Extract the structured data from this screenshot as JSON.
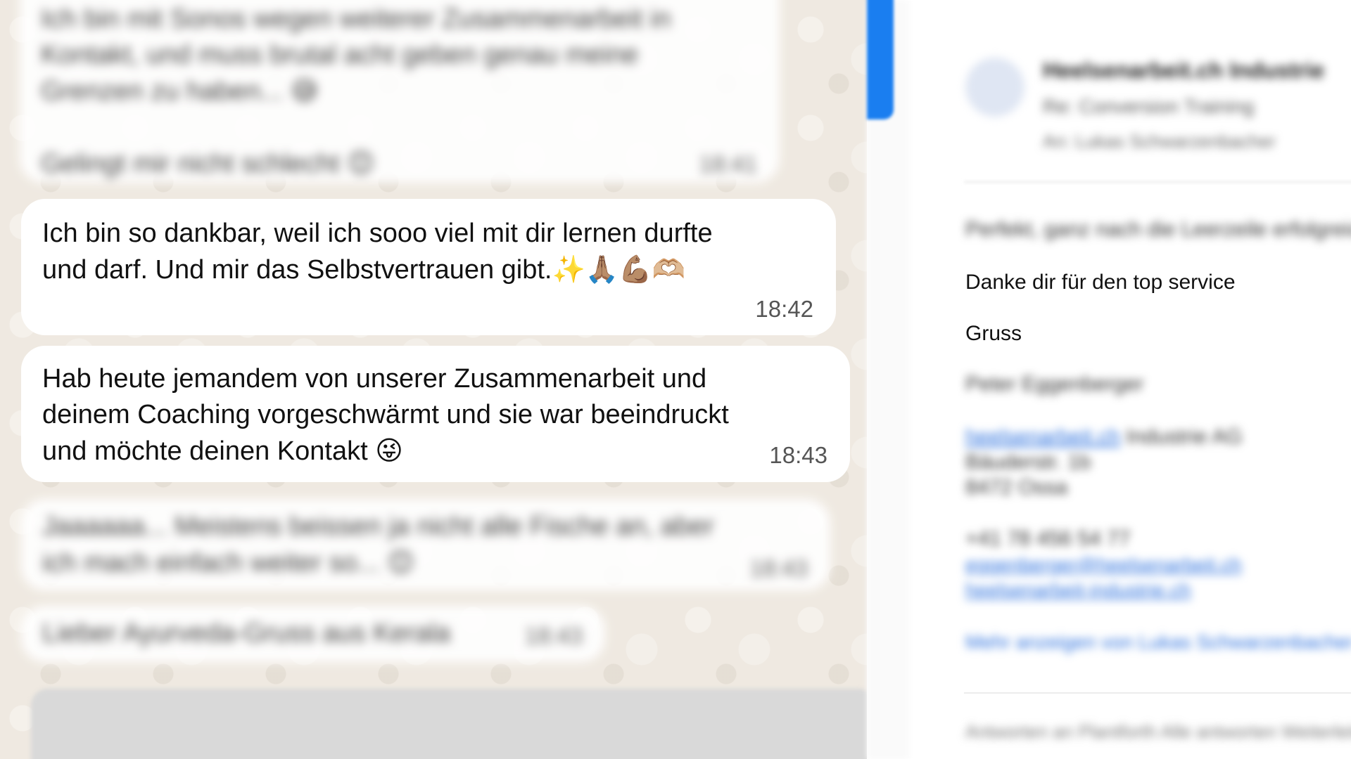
{
  "chat": {
    "messages": [
      {
        "text_line1": "Ich bin mit Sonos wegen weiterer Zusammenarbeit in",
        "text_line2": "Kontakt, und muss brutal acht geben genau meine",
        "text_line3": "Grenzen zu haben...",
        "emoji1": "😅",
        "text_line4": "Gelingt mir nicht schlecht",
        "emoji2": "😊",
        "time": "18:41",
        "blurred": true
      },
      {
        "text_line1": "Ich bin so dankbar, weil ich sooo viel mit dir lernen durfte",
        "text_line2": "und darf. Und mir das Selbstvertrauen gibt.",
        "emoji": "✨🙏🏽💪🏽🫶🏼",
        "time": "18:42",
        "blurred": false
      },
      {
        "text_line1": "Hab heute jemandem von unserer Zusammenarbeit und",
        "text_line2": "deinem Coaching vorgeschwärmt und sie war beeindruckt",
        "text_line3": "und möchte deinen Kontakt",
        "emoji": "😜",
        "time": "18:43",
        "blurred": false
      },
      {
        "text_line1": "Jaaaaaa... Meistens beissen ja nicht alle Fische an, aber",
        "text_line2": "ich mach einfach weiter so...",
        "emoji": "😊",
        "time": "18:43",
        "blurred": true
      },
      {
        "text_line1": "Lieber Ayurveda-Gruss aus Kerala",
        "time": "18:43",
        "blurred": true
      }
    ]
  },
  "mail": {
    "sender": "Heelsenarbeit.ch Industrie",
    "subject": "Re: Conversion Training",
    "to": "An: Lukas Schwarzenbacher",
    "intro": "Perfekt, ganz nach die Leerzeile erfolgreich",
    "thanks": "Danke dir für den top service",
    "greeting": "Gruss",
    "signature_name": "Peter Eggenberger",
    "company_link": "heelsenarbeit.ch",
    "company_suffix": " Industrie AG",
    "street": "Bäuderstr. 1b",
    "city": "8472 Ossa",
    "phone": "+41 78 456 54 77",
    "email_link": "eggenberger@heelsenarbeit.ch",
    "web_link": "heelsenarbeit-industrie.ch",
    "more_link": "Mehr anzeigen von Lukas Schwarzenbacher",
    "footer": "Antworten an Plantforth  Alle antworten  Weiterleiten"
  }
}
